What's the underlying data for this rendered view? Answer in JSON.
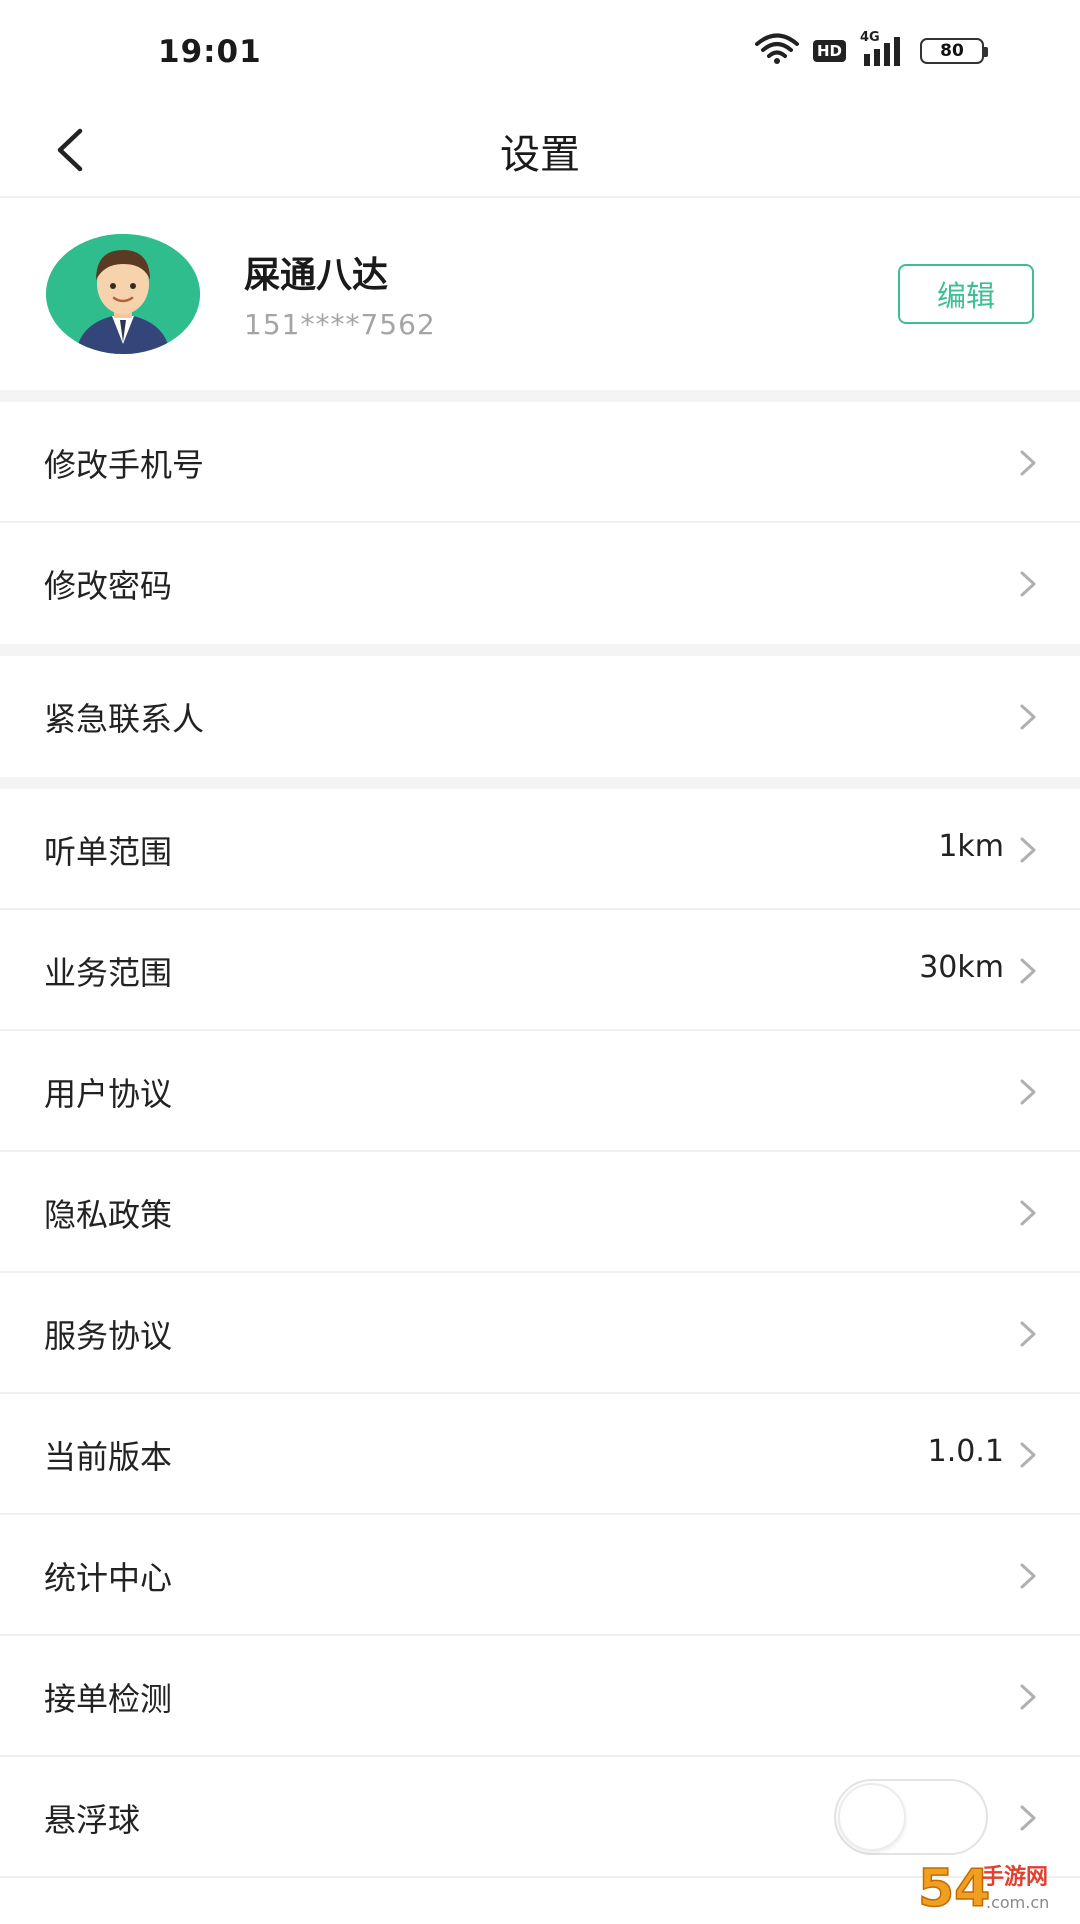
{
  "status_bar": {
    "time": "19:01",
    "hd_badge": "HD",
    "network": "4G",
    "battery": "80",
    "icons": [
      "wifi-icon",
      "hd-icon",
      "signal-4g-icon",
      "battery-icon"
    ]
  },
  "nav": {
    "title": "设置",
    "back_icon": "chevron-left-icon"
  },
  "profile": {
    "name": "屎通八达",
    "phone": "151****7562",
    "edit_label": "编辑",
    "avatar_icon": "businessman-avatar",
    "accent_color": "#3cbf92"
  },
  "settings": {
    "group1": [
      {
        "label": "修改手机号",
        "value": ""
      },
      {
        "label": "修改密码",
        "value": ""
      }
    ],
    "group2": [
      {
        "label": "紧急联系人",
        "value": ""
      }
    ],
    "group3": [
      {
        "label": "听单范围",
        "value": "1km"
      },
      {
        "label": "业务范围",
        "value": "30km"
      },
      {
        "label": "用户协议",
        "value": ""
      },
      {
        "label": "隐私政策",
        "value": ""
      },
      {
        "label": "服务协议",
        "value": ""
      },
      {
        "label": "当前版本",
        "value": "1.0.1"
      },
      {
        "label": "统计中心",
        "value": ""
      },
      {
        "label": "接单检测",
        "value": ""
      },
      {
        "label": "悬浮球",
        "value": "",
        "toggle_on": false
      }
    ]
  },
  "watermark": {
    "text": "54 手游网",
    "sub": ".com.cn"
  }
}
